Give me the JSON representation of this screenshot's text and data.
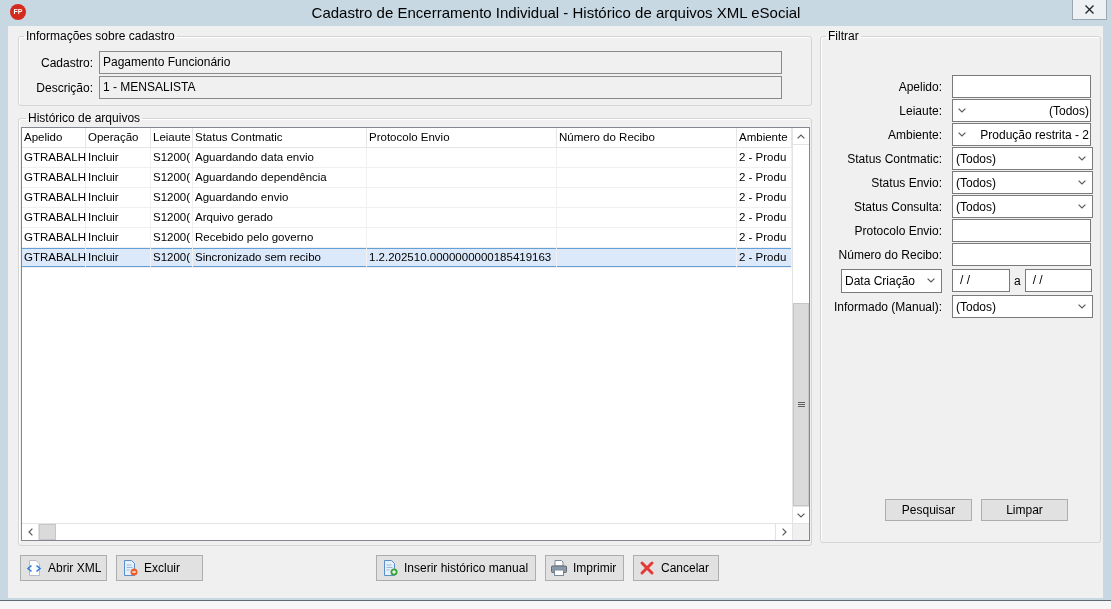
{
  "window": {
    "icon_label": "FP",
    "title": "Cadastro de Encerramento Individual - Histórico de arquivos XML eSocial"
  },
  "cadastro_info": {
    "title": "Informações sobre cadastro",
    "fields": [
      {
        "label": "Cadastro:",
        "value": "Pagamento Funcionário"
      },
      {
        "label": "Descrição:",
        "value": "1 - MENSALISTA"
      }
    ]
  },
  "history": {
    "title": "Histórico de arquivos",
    "columns": [
      "Apelido",
      "Operação",
      "Leiaute",
      "Status Contmatic",
      "Protocolo Envio",
      "Número do Recibo",
      "Ambiente"
    ],
    "rows": [
      {
        "apelido": "GTRABALH",
        "operacao": "Incluir",
        "leiaute": "S1200(",
        "status_contmatic": "Aguardando data envio",
        "ambiente": "2 - Produ",
        "selected": false
      },
      {
        "apelido": "GTRABALH",
        "operacao": "Incluir",
        "leiaute": "S1200(",
        "status_contmatic": "Aguardando dependência",
        "ambiente": "2 - Produ",
        "selected": false
      },
      {
        "apelido": "GTRABALH",
        "operacao": "Incluir",
        "leiaute": "S1200(",
        "status_contmatic": "Aguardando envio",
        "ambiente": "2 - Produ",
        "selected": false
      },
      {
        "apelido": "GTRABALH",
        "operacao": "Incluir",
        "leiaute": "S1200(",
        "status_contmatic": "Arquivo gerado",
        "ambiente": "2 - Produ",
        "selected": false
      },
      {
        "apelido": "GTRABALH",
        "operacao": "Incluir",
        "leiaute": "S1200(",
        "status_contmatic": "Recebido pelo governo",
        "ambiente": "2 - Produ",
        "selected": false
      },
      {
        "apelido": "GTRABALH",
        "operacao": "Incluir",
        "leiaute": "S1200(",
        "status_contmatic": "Sincronizado sem recibo",
        "protocolo_envio": "1.2.202510.0000000000185419163",
        "ambiente": "2 - Produ",
        "selected": true
      }
    ]
  },
  "filter": {
    "title": "Filtrar",
    "fields": [
      {
        "kind": "text",
        "label": "Apelido:"
      },
      {
        "kind": "picker",
        "label": "Leiaute:",
        "value": "(Todos)"
      },
      {
        "kind": "picker",
        "label": "Ambiente:",
        "value": "Produção restrita - 2"
      },
      {
        "kind": "select",
        "label": "Status Contmatic:",
        "value": "(Todos)"
      },
      {
        "kind": "select",
        "label": "Status Envio:",
        "value": "(Todos)"
      },
      {
        "kind": "select",
        "label": "Status Consulta:",
        "value": "(Todos)"
      },
      {
        "kind": "text",
        "label": "Protocolo Envio:"
      },
      {
        "kind": "text",
        "label": "Número do Recibo:"
      },
      {
        "kind": "daterange",
        "selector": "Data Criação",
        "from": "/ /",
        "separator": "a",
        "to": "/ /"
      },
      {
        "kind": "select",
        "label": "Informado (Manual):",
        "value": "(Todos)"
      }
    ],
    "buttons": [
      "Pesquisar",
      "Limpar"
    ]
  },
  "actions": {
    "left": [
      {
        "kind": "open",
        "label": "Abrir XML"
      },
      {
        "kind": "delete",
        "label": "Excluir"
      }
    ],
    "center": [
      {
        "kind": "insert",
        "label": "Inserir histórico manual"
      },
      {
        "kind": "print",
        "label": "Imprimir"
      },
      {
        "kind": "cancel",
        "label": "Cancelar"
      }
    ]
  }
}
